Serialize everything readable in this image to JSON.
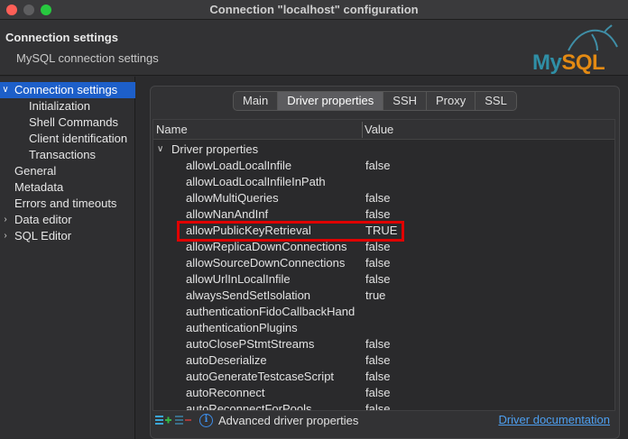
{
  "window": {
    "title": "Connection \"localhost\" configuration"
  },
  "header": {
    "title": "Connection settings",
    "subtitle": "MySQL connection settings",
    "logo_my": "My",
    "logo_sql": "SQL"
  },
  "sidebar": {
    "items": [
      {
        "label": "Connection settings",
        "arrow": "∨",
        "selected": true,
        "indent": 0
      },
      {
        "label": "Initialization",
        "arrow": "",
        "selected": false,
        "indent": 1
      },
      {
        "label": "Shell Commands",
        "arrow": "",
        "selected": false,
        "indent": 1
      },
      {
        "label": "Client identification",
        "arrow": "",
        "selected": false,
        "indent": 1
      },
      {
        "label": "Transactions",
        "arrow": "",
        "selected": false,
        "indent": 1
      },
      {
        "label": "General",
        "arrow": "",
        "selected": false,
        "indent": 0
      },
      {
        "label": "Metadata",
        "arrow": "",
        "selected": false,
        "indent": 0
      },
      {
        "label": "Errors and timeouts",
        "arrow": "",
        "selected": false,
        "indent": 0
      },
      {
        "label": "Data editor",
        "arrow": "›",
        "selected": false,
        "indent": 0
      },
      {
        "label": "SQL Editor",
        "arrow": "›",
        "selected": false,
        "indent": 0
      }
    ]
  },
  "tabs": [
    {
      "label": "Main",
      "active": false
    },
    {
      "label": "Driver properties",
      "active": true
    },
    {
      "label": "SSH",
      "active": false
    },
    {
      "label": "Proxy",
      "active": false
    },
    {
      "label": "SSL",
      "active": false
    }
  ],
  "grid": {
    "columns": {
      "name": "Name",
      "value": "Value"
    },
    "group": {
      "label": "Driver properties",
      "arrow": "∨"
    },
    "rows": [
      {
        "name": "allowLoadLocalInfile",
        "value": "false"
      },
      {
        "name": "allowLoadLocalInfileInPath",
        "value": ""
      },
      {
        "name": "allowMultiQueries",
        "value": "false"
      },
      {
        "name": "allowNanAndInf",
        "value": "false"
      },
      {
        "name": "allowPublicKeyRetrieval",
        "value": "TRUE"
      },
      {
        "name": "allowReplicaDownConnections",
        "value": "false"
      },
      {
        "name": "allowSourceDownConnections",
        "value": "false"
      },
      {
        "name": "allowUrlInLocalInfile",
        "value": "false"
      },
      {
        "name": "alwaysSendSetIsolation",
        "value": "true"
      },
      {
        "name": "authenticationFidoCallbackHand",
        "value": ""
      },
      {
        "name": "authenticationPlugins",
        "value": ""
      },
      {
        "name": "autoClosePStmtStreams",
        "value": "false"
      },
      {
        "name": "autoDeserialize",
        "value": "false"
      },
      {
        "name": "autoGenerateTestcaseScript",
        "value": "false"
      },
      {
        "name": "autoReconnect",
        "value": "false"
      },
      {
        "name": "autoReconnectForPools",
        "value": "false"
      }
    ]
  },
  "footer": {
    "info_glyph": "i",
    "info_text": "Advanced driver properties",
    "link": "Driver documentation"
  },
  "colors": {
    "selection": "#1d5fc9",
    "highlight_box": "#e00000",
    "link": "#4d9ff0"
  }
}
